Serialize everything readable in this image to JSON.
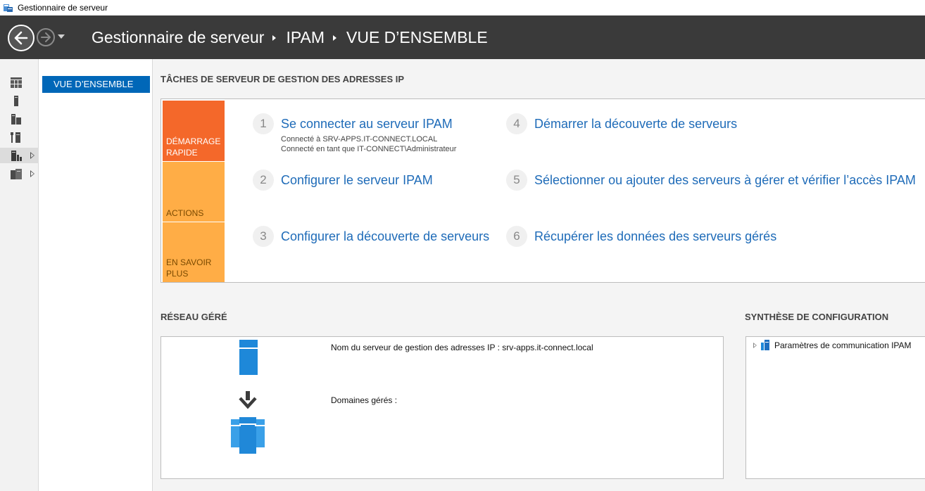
{
  "window": {
    "title": "Gestionnaire de serveur"
  },
  "header": {
    "breadcrumb": [
      "Gestionnaire de serveur",
      "IPAM",
      "VUE D’ENSEMBLE"
    ]
  },
  "rail": {
    "items": [
      {
        "icon": "dashboard-icon"
      },
      {
        "icon": "local-server-icon"
      },
      {
        "icon": "all-servers-icon"
      },
      {
        "icon": "tools-icon"
      },
      {
        "icon": "ipam-icon",
        "active": true,
        "expandable": true
      },
      {
        "icon": "file-services-icon",
        "expandable": true
      }
    ]
  },
  "subnav": {
    "items": [
      {
        "label": "VUE D’ENSEMBLE",
        "selected": true
      }
    ]
  },
  "tasks": {
    "title": "TÂCHES DE SERVEUR DE GESTION DES ADRESSES IP",
    "tiles": [
      "DÉMARRAGE RAPIDE",
      "ACTIONS",
      "EN SAVOIR PLUS"
    ],
    "steps": [
      {
        "num": "1",
        "label": "Se connecter au serveur IPAM",
        "sub": [
          "Connecté à SRV-APPS.IT-CONNECT.LOCAL",
          "Connecté en tant que IT-CONNECT\\Administrateur"
        ]
      },
      {
        "num": "2",
        "label": "Configurer le serveur IPAM"
      },
      {
        "num": "3",
        "label": "Configurer la découverte de serveurs"
      },
      {
        "num": "4",
        "label": "Démarrer la découverte de serveurs"
      },
      {
        "num": "5",
        "label": "Sélectionner ou ajouter des serveurs à gérer et vérifier l’accès IPAM"
      },
      {
        "num": "6",
        "label": "Récupérer les données des serveurs gérés"
      }
    ]
  },
  "network": {
    "title": "RÉSEAU GÉRÉ",
    "server_name_label": "Nom du serveur de gestion des adresses IP : srv-apps.it-connect.local",
    "domains_label": "Domaines gérés :"
  },
  "config": {
    "title": "SYNTHÈSE DE CONFIGURATION",
    "items": [
      {
        "label": "Paramètres de communication IPAM"
      }
    ]
  },
  "colors": {
    "accent": "#0067b8",
    "tile_primary": "#f4682a",
    "tile_secondary": "#ffad46",
    "link": "#1e6bb8",
    "header_bg": "#3a3a3a"
  }
}
